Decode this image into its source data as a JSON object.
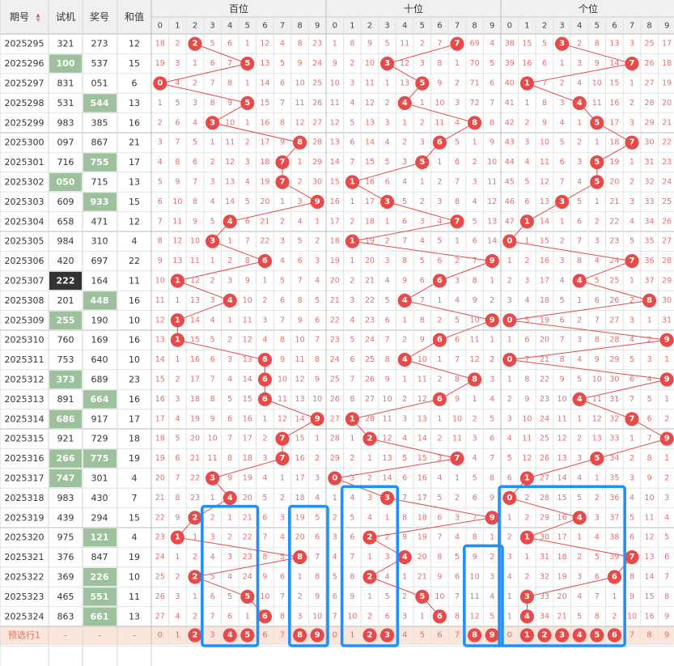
{
  "headers": {
    "issue": "期号",
    "sort_arrow": "▲▼",
    "test": "试机",
    "prize": "奖号",
    "sum": "和值",
    "groups": [
      "百位",
      "十位",
      "个位"
    ]
  },
  "digits": [
    "0",
    "1",
    "2",
    "3",
    "4",
    "5",
    "6",
    "7",
    "8",
    "9"
  ],
  "colors": {
    "red": "#e84a4a",
    "miss_text": "#e07070",
    "highlight_green": "#9dc09d",
    "highlight_dark": "#333333",
    "header_bg": "#f0f0f0",
    "box_blue": "#1e90ff",
    "pre_row_bg": "#fbe6dc"
  },
  "rows": [
    {
      "issue": "2025295",
      "test": "321",
      "prize": "273",
      "sum": "12",
      "test_hl": "",
      "prize_hl": "",
      "h": [
        "18",
        "2",
        "2",
        "5",
        "6",
        "1",
        "12",
        "4",
        "8",
        "23"
      ],
      "t": [
        "1",
        "8",
        "9",
        "5",
        "11",
        "2",
        "7",
        "7",
        "69",
        "4"
      ],
      "u": [
        "38",
        "15",
        "5",
        "3",
        "2",
        "8",
        "13",
        "3",
        "25",
        "17"
      ]
    },
    {
      "issue": "2025296",
      "test": "100",
      "prize": "537",
      "sum": "15",
      "test_hl": "green",
      "prize_hl": "",
      "h": [
        "19",
        "3",
        "1",
        "6",
        "7",
        "5",
        "13",
        "5",
        "9",
        "24"
      ],
      "t": [
        "9",
        "2",
        "10",
        "3",
        "12",
        "3",
        "8",
        "1",
        "70",
        "5"
      ],
      "u": [
        "39",
        "16",
        "6",
        "1",
        "3",
        "9",
        "14",
        "7",
        "26",
        "18"
      ]
    },
    {
      "issue": "2025297",
      "test": "831",
      "prize": "051",
      "sum": "6",
      "test_hl": "",
      "prize_hl": "",
      "h": [
        "0",
        "4",
        "2",
        "7",
        "8",
        "1",
        "14",
        "6",
        "10",
        "25"
      ],
      "t": [
        "10",
        "3",
        "11",
        "1",
        "13",
        "5",
        "9",
        "2",
        "71",
        "6"
      ],
      "u": [
        "40",
        "1",
        "7",
        "2",
        "4",
        "10",
        "15",
        "1",
        "27",
        "19"
      ]
    },
    {
      "issue": "2025298",
      "test": "531",
      "prize": "544",
      "sum": "13",
      "test_hl": "",
      "prize_hl": "green",
      "h": [
        "1",
        "5",
        "3",
        "8",
        "9",
        "5",
        "15",
        "7",
        "11",
        "26"
      ],
      "t": [
        "11",
        "4",
        "12",
        "2",
        "4",
        "1",
        "10",
        "3",
        "72",
        "7"
      ],
      "u": [
        "41",
        "1",
        "8",
        "3",
        "4",
        "11",
        "16",
        "2",
        "28",
        "20"
      ]
    },
    {
      "issue": "2025299",
      "test": "983",
      "prize": "385",
      "sum": "16",
      "test_hl": "",
      "prize_hl": "",
      "h": [
        "2",
        "6",
        "4",
        "3",
        "10",
        "1",
        "16",
        "8",
        "12",
        "27"
      ],
      "t": [
        "12",
        "5",
        "13",
        "3",
        "1",
        "2",
        "11",
        "4",
        "8",
        "8"
      ],
      "u": [
        "42",
        "2",
        "9",
        "4",
        "1",
        "5",
        "17",
        "3",
        "29",
        "21"
      ]
    },
    {
      "issue": "2025300",
      "test": "097",
      "prize": "867",
      "sum": "21",
      "test_hl": "",
      "prize_hl": "",
      "h": [
        "3",
        "7",
        "5",
        "1",
        "11",
        "2",
        "17",
        "9",
        "8",
        "28"
      ],
      "t": [
        "13",
        "6",
        "14",
        "4",
        "2",
        "3",
        "6",
        "5",
        "1",
        "9"
      ],
      "u": [
        "43",
        "3",
        "10",
        "5",
        "2",
        "1",
        "18",
        "7",
        "30",
        "22"
      ]
    },
    {
      "issue": "2025301",
      "test": "716",
      "prize": "755",
      "sum": "17",
      "test_hl": "",
      "prize_hl": "green",
      "h": [
        "4",
        "8",
        "6",
        "2",
        "12",
        "3",
        "18",
        "7",
        "1",
        "29"
      ],
      "t": [
        "14",
        "7",
        "15",
        "5",
        "3",
        "5",
        "1",
        "6",
        "2",
        "10"
      ],
      "u": [
        "44",
        "4",
        "11",
        "6",
        "3",
        "5",
        "19",
        "1",
        "31",
        "23"
      ]
    },
    {
      "issue": "2025302",
      "test": "050",
      "prize": "715",
      "sum": "13",
      "test_hl": "green",
      "prize_hl": "",
      "h": [
        "5",
        "9",
        "7",
        "3",
        "13",
        "4",
        "19",
        "7",
        "2",
        "30"
      ],
      "t": [
        "15",
        "1",
        "16",
        "6",
        "4",
        "1",
        "2",
        "7",
        "3",
        "11"
      ],
      "u": [
        "45",
        "5",
        "12",
        "7",
        "4",
        "5",
        "20",
        "2",
        "32",
        "24"
      ]
    },
    {
      "issue": "2025303",
      "test": "609",
      "prize": "933",
      "sum": "15",
      "test_hl": "",
      "prize_hl": "green",
      "h": [
        "6",
        "10",
        "8",
        "4",
        "14",
        "5",
        "20",
        "1",
        "3",
        "9"
      ],
      "t": [
        "16",
        "1",
        "17",
        "3",
        "5",
        "2",
        "3",
        "8",
        "4",
        "12"
      ],
      "u": [
        "46",
        "6",
        "13",
        "3",
        "5",
        "1",
        "21",
        "3",
        "33",
        "25"
      ]
    },
    {
      "issue": "2025304",
      "test": "658",
      "prize": "471",
      "sum": "12",
      "test_hl": "",
      "prize_hl": "",
      "h": [
        "7",
        "11",
        "9",
        "5",
        "4",
        "6",
        "21",
        "2",
        "4",
        "1"
      ],
      "t": [
        "17",
        "2",
        "18",
        "1",
        "6",
        "3",
        "4",
        "7",
        "5",
        "13"
      ],
      "u": [
        "47",
        "1",
        "14",
        "1",
        "6",
        "2",
        "22",
        "4",
        "34",
        "26"
      ]
    },
    {
      "issue": "2025305",
      "test": "984",
      "prize": "310",
      "sum": "4",
      "test_hl": "",
      "prize_hl": "",
      "h": [
        "8",
        "12",
        "10",
        "3",
        "1",
        "7",
        "22",
        "3",
        "5",
        "2"
      ],
      "t": [
        "18",
        "1",
        "19",
        "2",
        "7",
        "4",
        "5",
        "1",
        "6",
        "14"
      ],
      "u": [
        "0",
        "1",
        "15",
        "2",
        "7",
        "3",
        "23",
        "5",
        "35",
        "27"
      ]
    },
    {
      "issue": "2025306",
      "test": "420",
      "prize": "697",
      "sum": "22",
      "test_hl": "",
      "prize_hl": "",
      "h": [
        "9",
        "13",
        "11",
        "1",
        "2",
        "8",
        "6",
        "4",
        "6",
        "3"
      ],
      "t": [
        "19",
        "1",
        "20",
        "3",
        "8",
        "5",
        "6",
        "2",
        "7",
        "9"
      ],
      "u": [
        "1",
        "2",
        "16",
        "3",
        "8",
        "4",
        "24",
        "7",
        "36",
        "28"
      ]
    },
    {
      "issue": "2025307",
      "test": "222",
      "prize": "164",
      "sum": "11",
      "test_hl": "dark",
      "prize_hl": "",
      "h": [
        "10",
        "1",
        "12",
        "2",
        "3",
        "9",
        "1",
        "5",
        "7",
        "4"
      ],
      "t": [
        "20",
        "2",
        "21",
        "4",
        "9",
        "6",
        "6",
        "3",
        "8",
        "1"
      ],
      "u": [
        "2",
        "3",
        "17",
        "4",
        "4",
        "5",
        "25",
        "1",
        "37",
        "29"
      ]
    },
    {
      "issue": "2025308",
      "test": "201",
      "prize": "448",
      "sum": "16",
      "test_hl": "",
      "prize_hl": "green",
      "h": [
        "11",
        "1",
        "13",
        "3",
        "4",
        "10",
        "2",
        "6",
        "8",
        "5"
      ],
      "t": [
        "21",
        "3",
        "22",
        "5",
        "4",
        "7",
        "1",
        "4",
        "9",
        "2"
      ],
      "u": [
        "3",
        "4",
        "18",
        "5",
        "1",
        "6",
        "26",
        "2",
        "8",
        "30"
      ]
    },
    {
      "issue": "2025309",
      "test": "255",
      "prize": "190",
      "sum": "10",
      "test_hl": "green",
      "prize_hl": "",
      "h": [
        "12",
        "1",
        "14",
        "4",
        "1",
        "11",
        "3",
        "7",
        "9",
        "6"
      ],
      "t": [
        "22",
        "4",
        "23",
        "6",
        "1",
        "8",
        "2",
        "5",
        "10",
        "9"
      ],
      "u": [
        "0",
        "5",
        "19",
        "6",
        "2",
        "7",
        "27",
        "3",
        "1",
        "31"
      ]
    },
    {
      "issue": "2025310",
      "test": "760",
      "prize": "169",
      "sum": "16",
      "test_hl": "",
      "prize_hl": "",
      "h": [
        "13",
        "1",
        "15",
        "5",
        "2",
        "12",
        "4",
        "8",
        "10",
        "7"
      ],
      "t": [
        "23",
        "5",
        "24",
        "7",
        "2",
        "9",
        "6",
        "6",
        "11",
        "1"
      ],
      "u": [
        "1",
        "6",
        "20",
        "7",
        "3",
        "8",
        "28",
        "4",
        "2",
        "9"
      ]
    },
    {
      "issue": "2025311",
      "test": "753",
      "prize": "640",
      "sum": "10",
      "test_hl": "",
      "prize_hl": "",
      "h": [
        "14",
        "1",
        "16",
        "6",
        "3",
        "13",
        "6",
        "9",
        "11",
        "8"
      ],
      "t": [
        "24",
        "6",
        "25",
        "8",
        "4",
        "10",
        "1",
        "7",
        "12",
        "2"
      ],
      "u": [
        "0",
        "7",
        "21",
        "8",
        "4",
        "9",
        "29",
        "5",
        "3",
        "1"
      ]
    },
    {
      "issue": "2025312",
      "test": "373",
      "prize": "689",
      "sum": "23",
      "test_hl": "green",
      "prize_hl": "",
      "h": [
        "15",
        "2",
        "17",
        "7",
        "4",
        "14",
        "6",
        "10",
        "12",
        "9"
      ],
      "t": [
        "25",
        "7",
        "26",
        "9",
        "1",
        "11",
        "2",
        "8",
        "8",
        "3"
      ],
      "u": [
        "1",
        "8",
        "22",
        "9",
        "5",
        "10",
        "30",
        "6",
        "4",
        "9"
      ]
    },
    {
      "issue": "2025313",
      "test": "891",
      "prize": "664",
      "sum": "16",
      "test_hl": "",
      "prize_hl": "green",
      "h": [
        "16",
        "3",
        "18",
        "8",
        "5",
        "15",
        "6",
        "11",
        "13",
        "10"
      ],
      "t": [
        "26",
        "8",
        "27",
        "10",
        "2",
        "12",
        "6",
        "9",
        "1",
        "4"
      ],
      "u": [
        "2",
        "9",
        "23",
        "10",
        "4",
        "11",
        "31",
        "7",
        "5",
        "1"
      ]
    },
    {
      "issue": "2025314",
      "test": "686",
      "prize": "917",
      "sum": "17",
      "test_hl": "green",
      "prize_hl": "",
      "h": [
        "17",
        "4",
        "19",
        "9",
        "6",
        "16",
        "1",
        "12",
        "14",
        "9"
      ],
      "t": [
        "27",
        "1",
        "28",
        "11",
        "3",
        "13",
        "1",
        "10",
        "2",
        "5"
      ],
      "u": [
        "3",
        "10",
        "24",
        "11",
        "1",
        "12",
        "32",
        "7",
        "6",
        "2"
      ]
    },
    {
      "issue": "2025315",
      "test": "921",
      "prize": "729",
      "sum": "18",
      "test_hl": "",
      "prize_hl": "",
      "h": [
        "18",
        "5",
        "20",
        "10",
        "7",
        "17",
        "2",
        "7",
        "15",
        "1"
      ],
      "t": [
        "28",
        "1",
        "2",
        "12",
        "4",
        "14",
        "2",
        "11",
        "3",
        "6"
      ],
      "u": [
        "4",
        "11",
        "25",
        "12",
        "2",
        "13",
        "33",
        "1",
        "7",
        "9"
      ]
    },
    {
      "issue": "2025316",
      "test": "266",
      "prize": "775",
      "sum": "19",
      "test_hl": "green",
      "prize_hl": "green",
      "h": [
        "19",
        "6",
        "21",
        "11",
        "8",
        "18",
        "3",
        "7",
        "16",
        "2"
      ],
      "t": [
        "29",
        "2",
        "1",
        "13",
        "5",
        "15",
        "3",
        "7",
        "4",
        "7"
      ],
      "u": [
        "5",
        "12",
        "26",
        "13",
        "3",
        "5",
        "34",
        "2",
        "8",
        "1"
      ]
    },
    {
      "issue": "2025317",
      "test": "747",
      "prize": "301",
      "sum": "4",
      "test_hl": "green",
      "prize_hl": "",
      "h": [
        "20",
        "7",
        "22",
        "3",
        "9",
        "19",
        "4",
        "1",
        "17",
        "3"
      ],
      "t": [
        "0",
        "3",
        "2",
        "14",
        "6",
        "16",
        "4",
        "1",
        "5",
        "8"
      ],
      "u": [
        "6",
        "1",
        "27",
        "14",
        "4",
        "1",
        "35",
        "3",
        "9",
        "2"
      ]
    },
    {
      "issue": "2025318",
      "test": "983",
      "prize": "430",
      "sum": "7",
      "test_hl": "",
      "prize_hl": "",
      "h": [
        "21",
        "8",
        "23",
        "1",
        "4",
        "20",
        "5",
        "2",
        "18",
        "4"
      ],
      "t": [
        "1",
        "4",
        "3",
        "3",
        "7",
        "17",
        "5",
        "2",
        "6",
        "9"
      ],
      "u": [
        "0",
        "2",
        "28",
        "15",
        "5",
        "2",
        "36",
        "4",
        "10",
        "3"
      ]
    },
    {
      "issue": "2025319",
      "test": "439",
      "prize": "294",
      "sum": "15",
      "test_hl": "",
      "prize_hl": "",
      "h": [
        "22",
        "9",
        "2",
        "2",
        "1",
        "21",
        "6",
        "3",
        "19",
        "5"
      ],
      "t": [
        "2",
        "5",
        "4",
        "1",
        "8",
        "18",
        "6",
        "3",
        "7",
        "9"
      ],
      "u": [
        "1",
        "2",
        "29",
        "16",
        "4",
        "3",
        "37",
        "5",
        "11",
        "4"
      ]
    },
    {
      "issue": "2025320",
      "test": "975",
      "prize": "121",
      "sum": "4",
      "test_hl": "",
      "prize_hl": "green",
      "h": [
        "23",
        "1",
        "1",
        "3",
        "2",
        "22",
        "7",
        "4",
        "20",
        "6"
      ],
      "t": [
        "3",
        "6",
        "2",
        "2",
        "9",
        "19",
        "7",
        "4",
        "8",
        "1"
      ],
      "u": [
        "2",
        "1",
        "30",
        "17",
        "1",
        "4",
        "38",
        "6",
        "12",
        "5"
      ]
    },
    {
      "issue": "2025321",
      "test": "376",
      "prize": "847",
      "sum": "19",
      "test_hl": "",
      "prize_hl": "",
      "h": [
        "24",
        "1",
        "2",
        "4",
        "3",
        "23",
        "8",
        "5",
        "8",
        "7"
      ],
      "t": [
        "4",
        "7",
        "1",
        "3",
        "4",
        "20",
        "8",
        "5",
        "9",
        "2"
      ],
      "u": [
        "3",
        "1",
        "31",
        "18",
        "2",
        "5",
        "39",
        "7",
        "13",
        "6"
      ]
    },
    {
      "issue": "2025322",
      "test": "369",
      "prize": "226",
      "sum": "10",
      "test_hl": "",
      "prize_hl": "green",
      "h": [
        "25",
        "2",
        "2",
        "5",
        "4",
        "24",
        "9",
        "6",
        "1",
        "8"
      ],
      "t": [
        "5",
        "8",
        "2",
        "4",
        "1",
        "21",
        "9",
        "6",
        "10",
        "3"
      ],
      "u": [
        "4",
        "2",
        "32",
        "19",
        "3",
        "6",
        "6",
        "8",
        "14",
        "7"
      ]
    },
    {
      "issue": "2025323",
      "test": "465",
      "prize": "551",
      "sum": "11",
      "test_hl": "",
      "prize_hl": "green",
      "h": [
        "26",
        "3",
        "1",
        "6",
        "5",
        "5",
        "10",
        "7",
        "2",
        "9"
      ],
      "t": [
        "6",
        "9",
        "1",
        "5",
        "2",
        "5",
        "10",
        "7",
        "11",
        "4"
      ],
      "u": [
        "1",
        "3",
        "33",
        "20",
        "4",
        "7",
        "1",
        "9",
        "15",
        "8"
      ]
    },
    {
      "issue": "2025324",
      "test": "863",
      "prize": "661",
      "sum": "13",
      "test_hl": "",
      "prize_hl": "green",
      "h": [
        "27",
        "4",
        "2",
        "7",
        "6",
        "1",
        "6",
        "8",
        "3",
        "10"
      ],
      "t": [
        "7",
        "10",
        "2",
        "6",
        "3",
        "1",
        "6",
        "8",
        "12",
        "5"
      ],
      "u": [
        "1",
        "4",
        "34",
        "21",
        "5",
        "8",
        "2",
        "10",
        "16",
        "9"
      ]
    }
  ],
  "pre_row": {
    "label": "预选行1",
    "dashes": [
      "-",
      "-",
      "-"
    ],
    "h": [
      "2",
      "4",
      "5",
      "8",
      "9"
    ],
    "t": [
      "2",
      "3",
      "8",
      "9"
    ],
    "u": [
      "1",
      "2",
      "3",
      "4",
      "5",
      "6"
    ]
  }
}
